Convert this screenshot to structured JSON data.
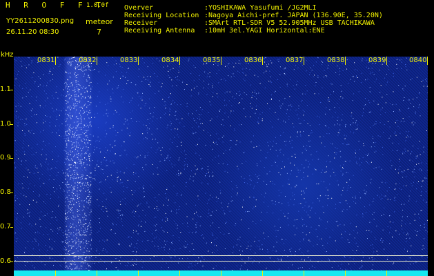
{
  "header": {
    "brand": "H R O F F T",
    "version": "1.0.0f",
    "filename": "YY2611200830.png",
    "timestamp": "26.11.20 08:30",
    "count_label": "meteor",
    "count_value": "7"
  },
  "station": [
    {
      "key": "Overver",
      "value": ":YOSHIKAWA Yasufumi /JG2MLI"
    },
    {
      "key": "Receiving Location",
      "value": ":Nagoya Aichi-pref. JAPAN (136.90E, 35.20N)"
    },
    {
      "key": "Receiver",
      "value": ":SMArt RTL-SDR V5 52.905MHz USB TACHIKAWA"
    },
    {
      "key": "Receiving Antenna",
      "value": ":10mH 3el.YAGI Horizontal:ENE"
    }
  ],
  "y_axis": {
    "unit": "kHz",
    "ticks": [
      "1.1",
      "1.0",
      "0.9",
      "0.8",
      "0.7",
      "0.6"
    ]
  },
  "time_axis": {
    "labels": [
      "0831",
      "0832",
      "0833",
      "0834",
      "0835",
      "0836",
      "0837",
      "0838",
      "0839",
      "0840"
    ]
  },
  "colors": {
    "label": "#f2f200",
    "background": "#000000",
    "spectrogram": "#0c2182",
    "baseline": "#16e8f0"
  }
}
